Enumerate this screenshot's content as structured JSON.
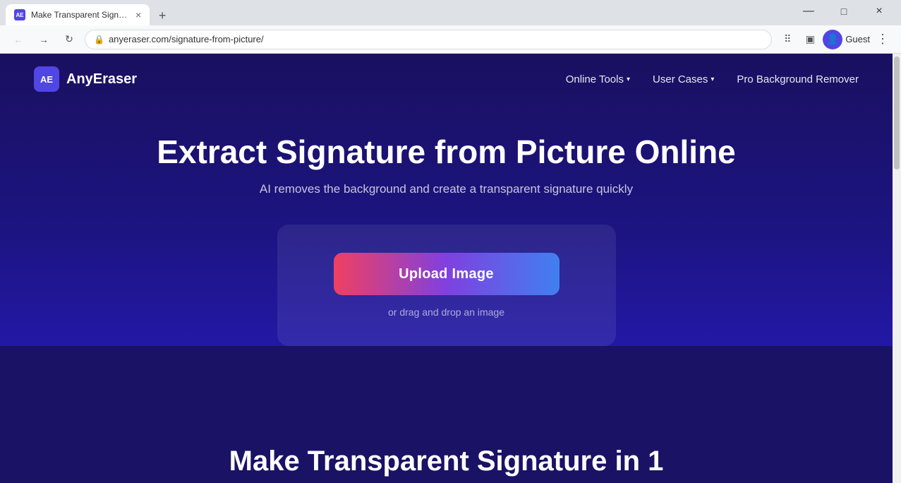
{
  "browser": {
    "tab": {
      "favicon_label": "AE",
      "title": "Make Transparent Signature fr",
      "close_symbol": "×"
    },
    "tab_add_symbol": "+",
    "window_controls": {
      "minimize": "—",
      "maximize": "□",
      "close": "×"
    },
    "nav": {
      "back": "←",
      "forward": "→",
      "refresh": "↻",
      "lock": "🔒",
      "url": "anyeraser.com/signature-from-picture/",
      "grid_icon": "⠿",
      "sidebar_icon": "▣",
      "user_icon": "👤",
      "guest_label": "Guest",
      "menu_icon": "⋮"
    }
  },
  "site": {
    "logo": {
      "abbr": "AE",
      "name": "AnyEraser"
    },
    "nav": {
      "tools_label": "Online Tools",
      "tools_chevron": "▾",
      "cases_label": "User Cases",
      "cases_chevron": "▾",
      "pro_label": "Pro Background Remover"
    },
    "hero": {
      "title": "Extract Signature from Picture Online",
      "subtitle": "AI removes the background and create a transparent signature quickly"
    },
    "upload": {
      "button_label": "Upload Image",
      "drag_hint": "or drag and drop an image"
    },
    "bottom": {
      "title": "Make Transparent Signature in 1"
    }
  }
}
